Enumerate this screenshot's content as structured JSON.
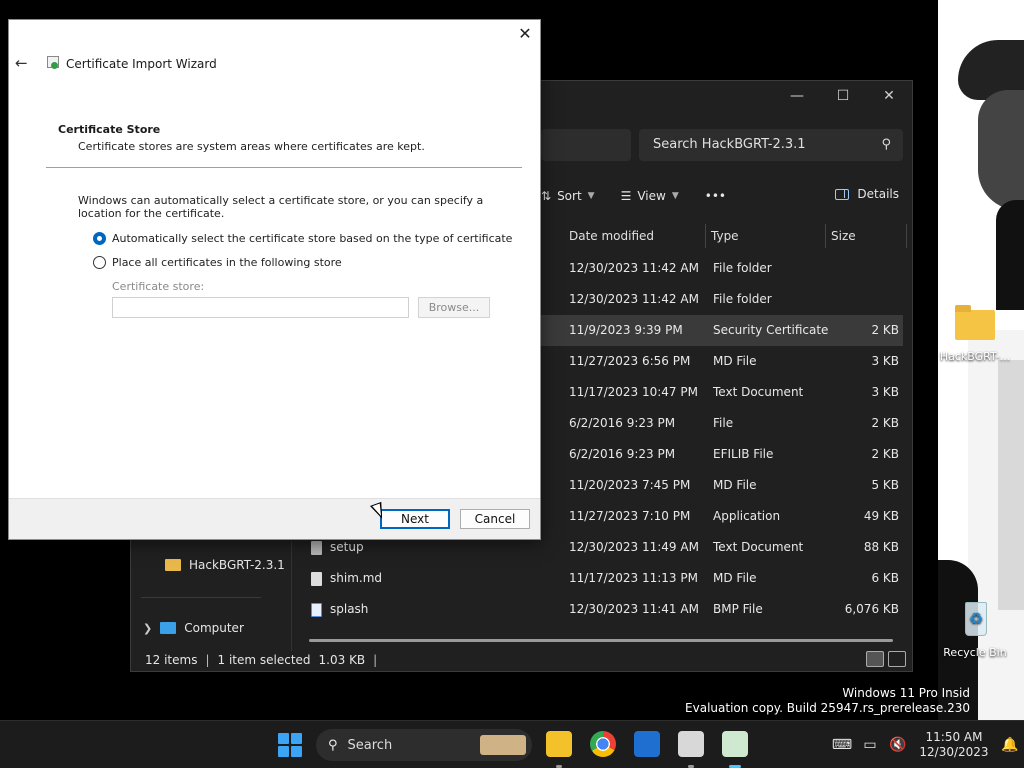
{
  "desktop": {
    "folder_icon_label": "HackBGRT-...",
    "recycle_bin_label": "Recycle Bin",
    "watermark_line1": "Windows 11 Pro Insid",
    "watermark_line2": "Evaluation copy. Build 25947.rs_prerelease.230"
  },
  "explorer": {
    "search_placeholder": "Search HackBGRT-2.3.1",
    "controls": {
      "minimize": "—",
      "maximize": "☐",
      "close": "✕"
    },
    "cmdbar": {
      "sort": "Sort",
      "view": "View",
      "more": "•••",
      "details": "Details"
    },
    "columns": {
      "date": "Date modified",
      "type": "Type",
      "size": "Size"
    },
    "rows": [
      {
        "name": "",
        "date": "12/30/2023 11:42 AM",
        "type": "File folder",
        "size": ""
      },
      {
        "name": "",
        "date": "12/30/2023 11:42 AM",
        "type": "File folder",
        "size": ""
      },
      {
        "name": "",
        "date": "11/9/2023 9:39 PM",
        "type": "Security Certificate",
        "size": "2 KB"
      },
      {
        "name": "",
        "date": "11/27/2023 6:56 PM",
        "type": "MD File",
        "size": "3 KB"
      },
      {
        "name": "",
        "date": "11/17/2023 10:47 PM",
        "type": "Text Document",
        "size": "3 KB"
      },
      {
        "name": "",
        "date": "6/2/2016 9:23 PM",
        "type": "File",
        "size": "2 KB"
      },
      {
        "name": "",
        "date": "6/2/2016 9:23 PM",
        "type": "EFILIB File",
        "size": "2 KB"
      },
      {
        "name": "",
        "date": "11/20/2023 7:45 PM",
        "type": "MD File",
        "size": "5 KB"
      },
      {
        "name": "",
        "date": "11/27/2023 7:10 PM",
        "type": "Application",
        "size": "49 KB"
      },
      {
        "name": "setup",
        "date": "12/30/2023 11:49 AM",
        "type": "Text Document",
        "size": "88 KB"
      },
      {
        "name": "shim.md",
        "date": "11/17/2023 11:13 PM",
        "type": "MD File",
        "size": "6 KB"
      },
      {
        "name": "splash",
        "date": "12/30/2023 11:41 AM",
        "type": "BMP File",
        "size": "6,076 KB"
      }
    ],
    "nav": {
      "folder": "HackBGRT-2.3.1",
      "computer": "Computer"
    },
    "status": {
      "items": "12 items",
      "selected": "1 item selected",
      "size": "1.03 KB"
    }
  },
  "wizard": {
    "title": "Certificate Import Wizard",
    "heading": "Certificate Store",
    "subheading": "Certificate stores are system areas where certificates are kept.",
    "body": "Windows can automatically select a certificate store, or you can specify a location for the certificate.",
    "option_auto": "Automatically select the certificate store based on the type of certificate",
    "option_manual": "Place all certificates in the following store",
    "store_label": "Certificate store:",
    "store_value": "",
    "browse": "Browse...",
    "next": "Next",
    "cancel": "Cancel",
    "close": "✕",
    "back": "←"
  },
  "taskbar": {
    "search": "Search",
    "time": "11:50 AM",
    "date": "12/30/2023"
  },
  "colors": {
    "accent": "#0067c0",
    "explorer_bg": "#202020",
    "taskbar_bg": "#1c1c1c"
  }
}
